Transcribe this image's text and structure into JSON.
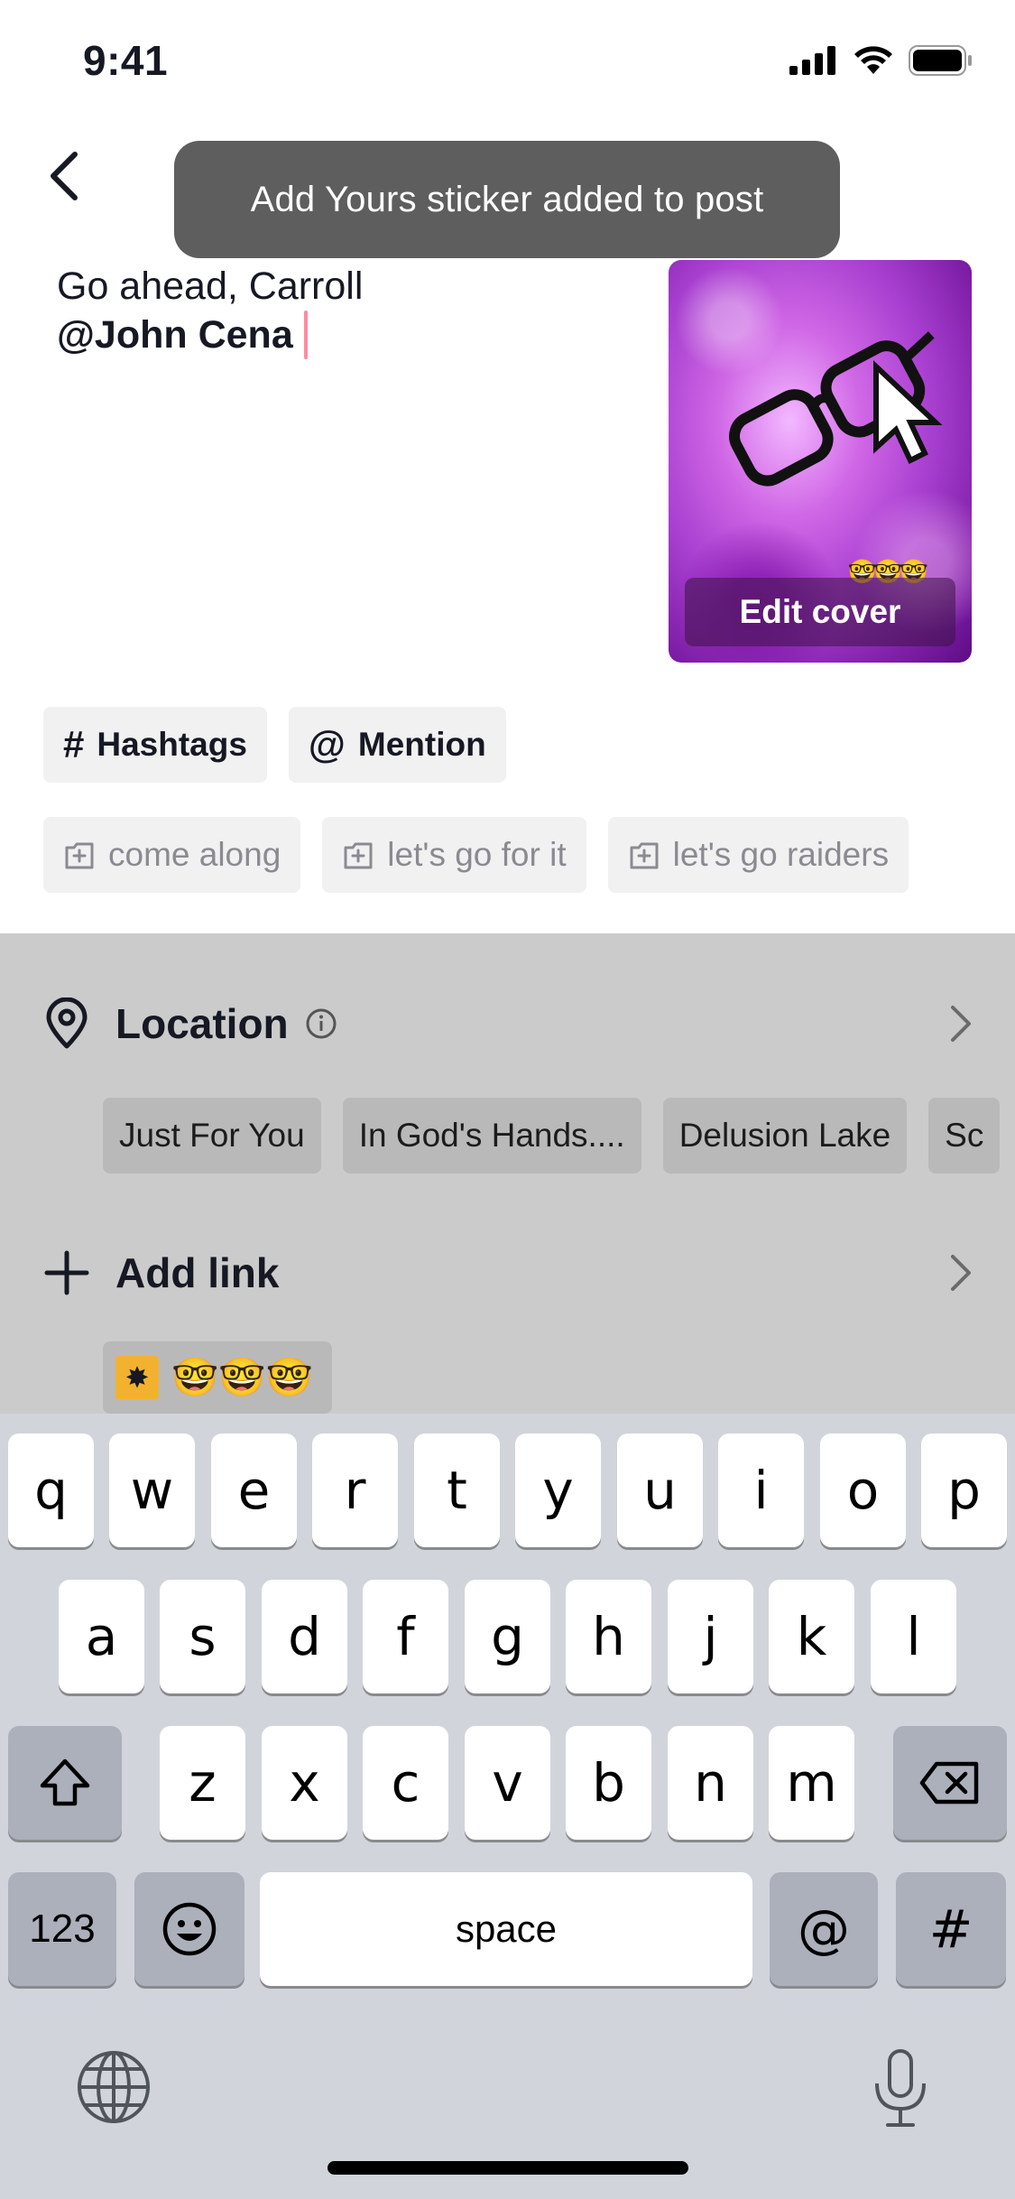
{
  "status_bar": {
    "time": "9:41"
  },
  "toast": {
    "text": "Add Yours sticker added to post"
  },
  "caption": {
    "line1": "Go ahead, Carroll",
    "line2": "@John Cena"
  },
  "cover": {
    "edit_label": "Edit cover",
    "emoji": "🤓🤓🤓"
  },
  "chips_primary": [
    {
      "symbol": "#",
      "label": "Hashtags"
    },
    {
      "symbol": "@",
      "label": "Mention"
    }
  ],
  "chips_suggestions": [
    {
      "icon": "add-sticker-icon",
      "label": "come along"
    },
    {
      "icon": "add-sticker-icon",
      "label": "let's go for it"
    },
    {
      "icon": "add-sticker-icon",
      "label": "let's go raiders"
    }
  ],
  "location": {
    "title": "Location",
    "chips": [
      "Just For You",
      "In God's Hands....",
      "Delusion Lake",
      "Sc"
    ]
  },
  "add_link": {
    "title": "Add link",
    "chip_emoji": "🤓🤓🤓"
  },
  "keyboard": {
    "row1": [
      "q",
      "w",
      "e",
      "r",
      "t",
      "y",
      "u",
      "i",
      "o",
      "p"
    ],
    "row2": [
      "a",
      "s",
      "d",
      "f",
      "g",
      "h",
      "j",
      "k",
      "l"
    ],
    "row3": [
      "z",
      "x",
      "c",
      "v",
      "b",
      "n",
      "m"
    ],
    "numbers_label": "123",
    "space_label": "space",
    "at_label": "@",
    "hash_label": "#"
  },
  "colors": {
    "accent": "#fe2c55",
    "toast_bg": "#5e5e5e",
    "keyboard_bg": "#d1d4db"
  }
}
